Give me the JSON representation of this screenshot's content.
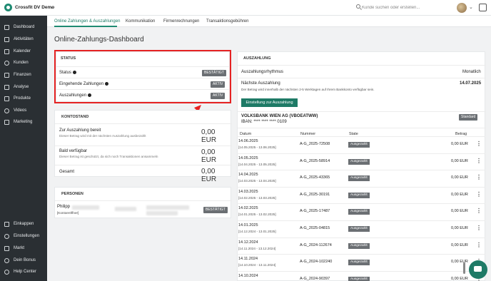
{
  "app": {
    "name": "Crossfit DV Demo"
  },
  "search": {
    "placeholder": "Kunde suchen oder erstellen..."
  },
  "sidebar": {
    "items": [
      {
        "label": "Dashboard",
        "icon": "dashboard-icon"
      },
      {
        "label": "Aktivitäten",
        "icon": "activity-icon"
      },
      {
        "label": "Kalender",
        "icon": "calendar-icon"
      },
      {
        "label": "Kunden",
        "icon": "user-icon"
      },
      {
        "label": "Finanzen",
        "icon": "finance-icon"
      },
      {
        "label": "Analyse",
        "icon": "analytics-icon"
      },
      {
        "label": "Produkte",
        "icon": "products-icon"
      },
      {
        "label": "Videos",
        "icon": "video-icon"
      },
      {
        "label": "Marketing",
        "icon": "marketing-icon"
      }
    ],
    "bottom_items": [
      {
        "label": "Einkappen",
        "icon": "key-icon"
      },
      {
        "label": "Einstellungen",
        "icon": "gear-icon"
      },
      {
        "label": "Markt",
        "icon": "market-icon"
      },
      {
        "label": "Dein Bonus",
        "icon": "heart-icon"
      },
      {
        "label": "Help Center",
        "icon": "help-icon"
      }
    ]
  },
  "tabs": [
    {
      "label": "Online Zahlungen & Auszahlungen",
      "active": true
    },
    {
      "label": "Kommunikation",
      "active": false
    },
    {
      "label": "Firmenrechnungen",
      "active": false
    },
    {
      "label": "Transaktionsgebühren",
      "active": false
    }
  ],
  "page": {
    "title": "Online-Zahlungs-Dashboard"
  },
  "status_card": {
    "title": "STATUS",
    "rows": [
      {
        "label": "Status",
        "badge": "BESTÄTIGT"
      },
      {
        "label": "Eingehende Zahlungen",
        "badge": "AKTIV"
      },
      {
        "label": "Auszahlungen",
        "badge": "AKTIV"
      }
    ]
  },
  "balance_card": {
    "title": "KONTOSTAND",
    "rows": [
      {
        "label": "Zur Auszahlung bereit",
        "sub": "Dieser Betrag wird mit der nächsten Auszahlung ausbezahlt",
        "amount": "0,00 EUR"
      },
      {
        "label": "Bald verfügbar",
        "sub": "Dieser Betrag ist geschützt, da sich noch Transaktionen ansammeln",
        "amount": "0,00 EUR"
      },
      {
        "label": "Gesamt",
        "amount": "0,00 EUR"
      }
    ]
  },
  "persons_card": {
    "title": "PERSONEN",
    "person_name": "Philipp",
    "person_role": "[Kontoeröffner]",
    "badge": "BESTÄTIGT"
  },
  "payout_card": {
    "title": "AUSZAHLUNG",
    "rhythm_label": "Auszahlungsrhythmus",
    "rhythm_value": "Monatlich",
    "next_label": "Nächste Auszahlung",
    "next_date": "14.07.2025",
    "next_sub": "Der Betrag wird innerhalb der nächsten 2-5 Werktagen auf Ihrem Bankkonto verfügbar sein.",
    "button": "Einstellung zur Auszahlung",
    "bank_name": "VOLKSBANK WIEN AG (VBOEATWW)",
    "iban": "IBAN: **** **** **** 0109",
    "bank_badge": "Standard",
    "columns": [
      "Datum",
      "Nummer",
      "State",
      "Betrag"
    ],
    "rows": [
      {
        "date": "14.06.2025",
        "range": "[14.05.2025 - 13.06.2025]",
        "number": "A-G_2025-72508",
        "state": "Ausgezahlt",
        "amount": "0,00 EUR"
      },
      {
        "date": "14.05.2025",
        "range": "[14.04.2025 - 13.05.2025]",
        "number": "A-G_2025-58914",
        "state": "Ausgezahlt",
        "amount": "0,00 EUR"
      },
      {
        "date": "14.04.2025",
        "range": "[14.03.2025 - 13.04.2025]",
        "number": "A-G_2025-43365",
        "state": "Ausgezahlt",
        "amount": "0,00 EUR"
      },
      {
        "date": "14.03.2025",
        "range": "[14.02.2025 - 13.03.2025]",
        "number": "A-G_2025-30191",
        "state": "Ausgezahlt",
        "amount": "0,00 EUR"
      },
      {
        "date": "14.02.2025",
        "range": "[14.01.2025 - 13.02.2025]",
        "number": "A-G_2025-17487",
        "state": "Ausgezahlt",
        "amount": "0,00 EUR"
      },
      {
        "date": "14.01.2025",
        "range": "[14.12.2024 - 13.01.2025]",
        "number": "A-G_2025-04815",
        "state": "Ausgezahlt",
        "amount": "0,00 EUR"
      },
      {
        "date": "14.12.2024",
        "range": "[14.11.2024 - 13.12.2024]",
        "number": "A-G_2024-112674",
        "state": "Ausgezahlt",
        "amount": "0,00 EUR"
      },
      {
        "date": "14.11.2024",
        "range": "[14.10.2024 - 13.11.2024]",
        "number": "A-G_2024-102240",
        "state": "Ausgezahlt",
        "amount": "0,00 EUR"
      },
      {
        "date": "14.10.2024",
        "range": "",
        "number": "A-G_2024-90397",
        "state": "Ausgezahlt",
        "amount": "0,00 EUR"
      }
    ]
  },
  "colors": {
    "brand": "#1e7a66",
    "sidebar": "#2a2f33",
    "highlight": "#e52222"
  }
}
